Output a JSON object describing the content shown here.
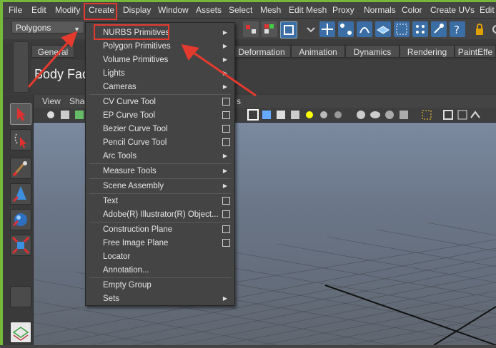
{
  "menubar": {
    "items": [
      "File",
      "Edit",
      "Modify",
      "Create",
      "Display",
      "Window",
      "Assets",
      "Select",
      "Mesh",
      "Edit Mesh",
      "Proxy",
      "Normals",
      "Color",
      "Create UVs",
      "Edit"
    ]
  },
  "mode_selector": {
    "value": "Polygons"
  },
  "shelf": {
    "tabs": [
      "General",
      "Deformation",
      "Animation",
      "Dynamics",
      "Rendering",
      "PaintEffe"
    ],
    "body_face_label": "Body Face"
  },
  "viewport": {
    "menu": [
      "View",
      "Shad"
    ],
    "partial_tail": "s"
  },
  "create_menu": {
    "items": [
      {
        "label": "NURBS Primitives",
        "kind": "submenu"
      },
      {
        "label": "Polygon Primitives",
        "kind": "submenu"
      },
      {
        "label": "Volume Primitives",
        "kind": "submenu"
      },
      {
        "label": "Lights",
        "kind": "submenu"
      },
      {
        "label": "Cameras",
        "kind": "submenu"
      },
      {
        "label": "CV Curve Tool",
        "kind": "option"
      },
      {
        "label": "EP Curve Tool",
        "kind": "option"
      },
      {
        "label": "Bezier Curve Tool",
        "kind": "option"
      },
      {
        "label": "Pencil Curve Tool",
        "kind": "option"
      },
      {
        "label": "Arc Tools",
        "kind": "submenu"
      },
      {
        "label": "Measure Tools",
        "kind": "submenu"
      },
      {
        "label": "Scene Assembly",
        "kind": "submenu"
      },
      {
        "label": "Text",
        "kind": "option"
      },
      {
        "label": "Adobe(R) Illustrator(R) Object...",
        "kind": "option"
      },
      {
        "label": "Construction Plane",
        "kind": "option"
      },
      {
        "label": "Free Image Plane",
        "kind": "option"
      },
      {
        "label": "Locator",
        "kind": "plain"
      },
      {
        "label": "Annotation...",
        "kind": "plain"
      },
      {
        "label": "Empty Group",
        "kind": "plain"
      },
      {
        "label": "Sets",
        "kind": "submenu"
      }
    ]
  },
  "colors": {
    "highlight": "#e53a2e",
    "menu_bg": "#444444",
    "viewport_top": "#7b8aa0"
  }
}
